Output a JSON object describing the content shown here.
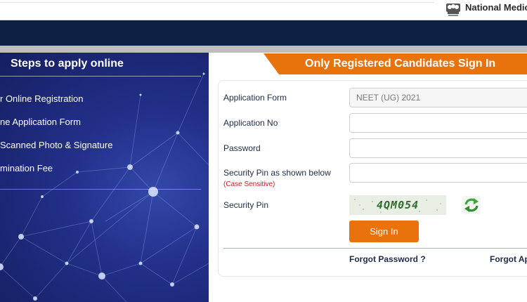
{
  "header": {
    "brand": "National Medic",
    "logo_icon": "national-emblem-icon"
  },
  "steps_panel": {
    "title": "Steps to apply online",
    "steps": [
      "r Online Registration",
      "ne Application Form",
      "Scanned Photo & Signature",
      "mination Fee"
    ]
  },
  "signin": {
    "banner": "Only Registered Candidates Sign In",
    "labels": {
      "application_form": "Application Form",
      "application_no": "Application No",
      "password": "Password",
      "security_pin_shown": "Security Pin as shown below",
      "case_sensitive": "(Case Sensitive)",
      "security_pin": "Security Pin"
    },
    "application_form_value": "NEET (UG) 2021",
    "captcha_text": "4QM054",
    "refresh_icon": "refresh-icon",
    "button_label": "Sign In",
    "forgot_password": "Forgot Password ?",
    "forgot_application": "Forgot Ap"
  },
  "colors": {
    "navy": "#0c2244",
    "accent_orange": "#e8720c",
    "panel_blue": "#22308a",
    "label_text": "#1d2b4a",
    "warning_red": "#d01c1c"
  }
}
